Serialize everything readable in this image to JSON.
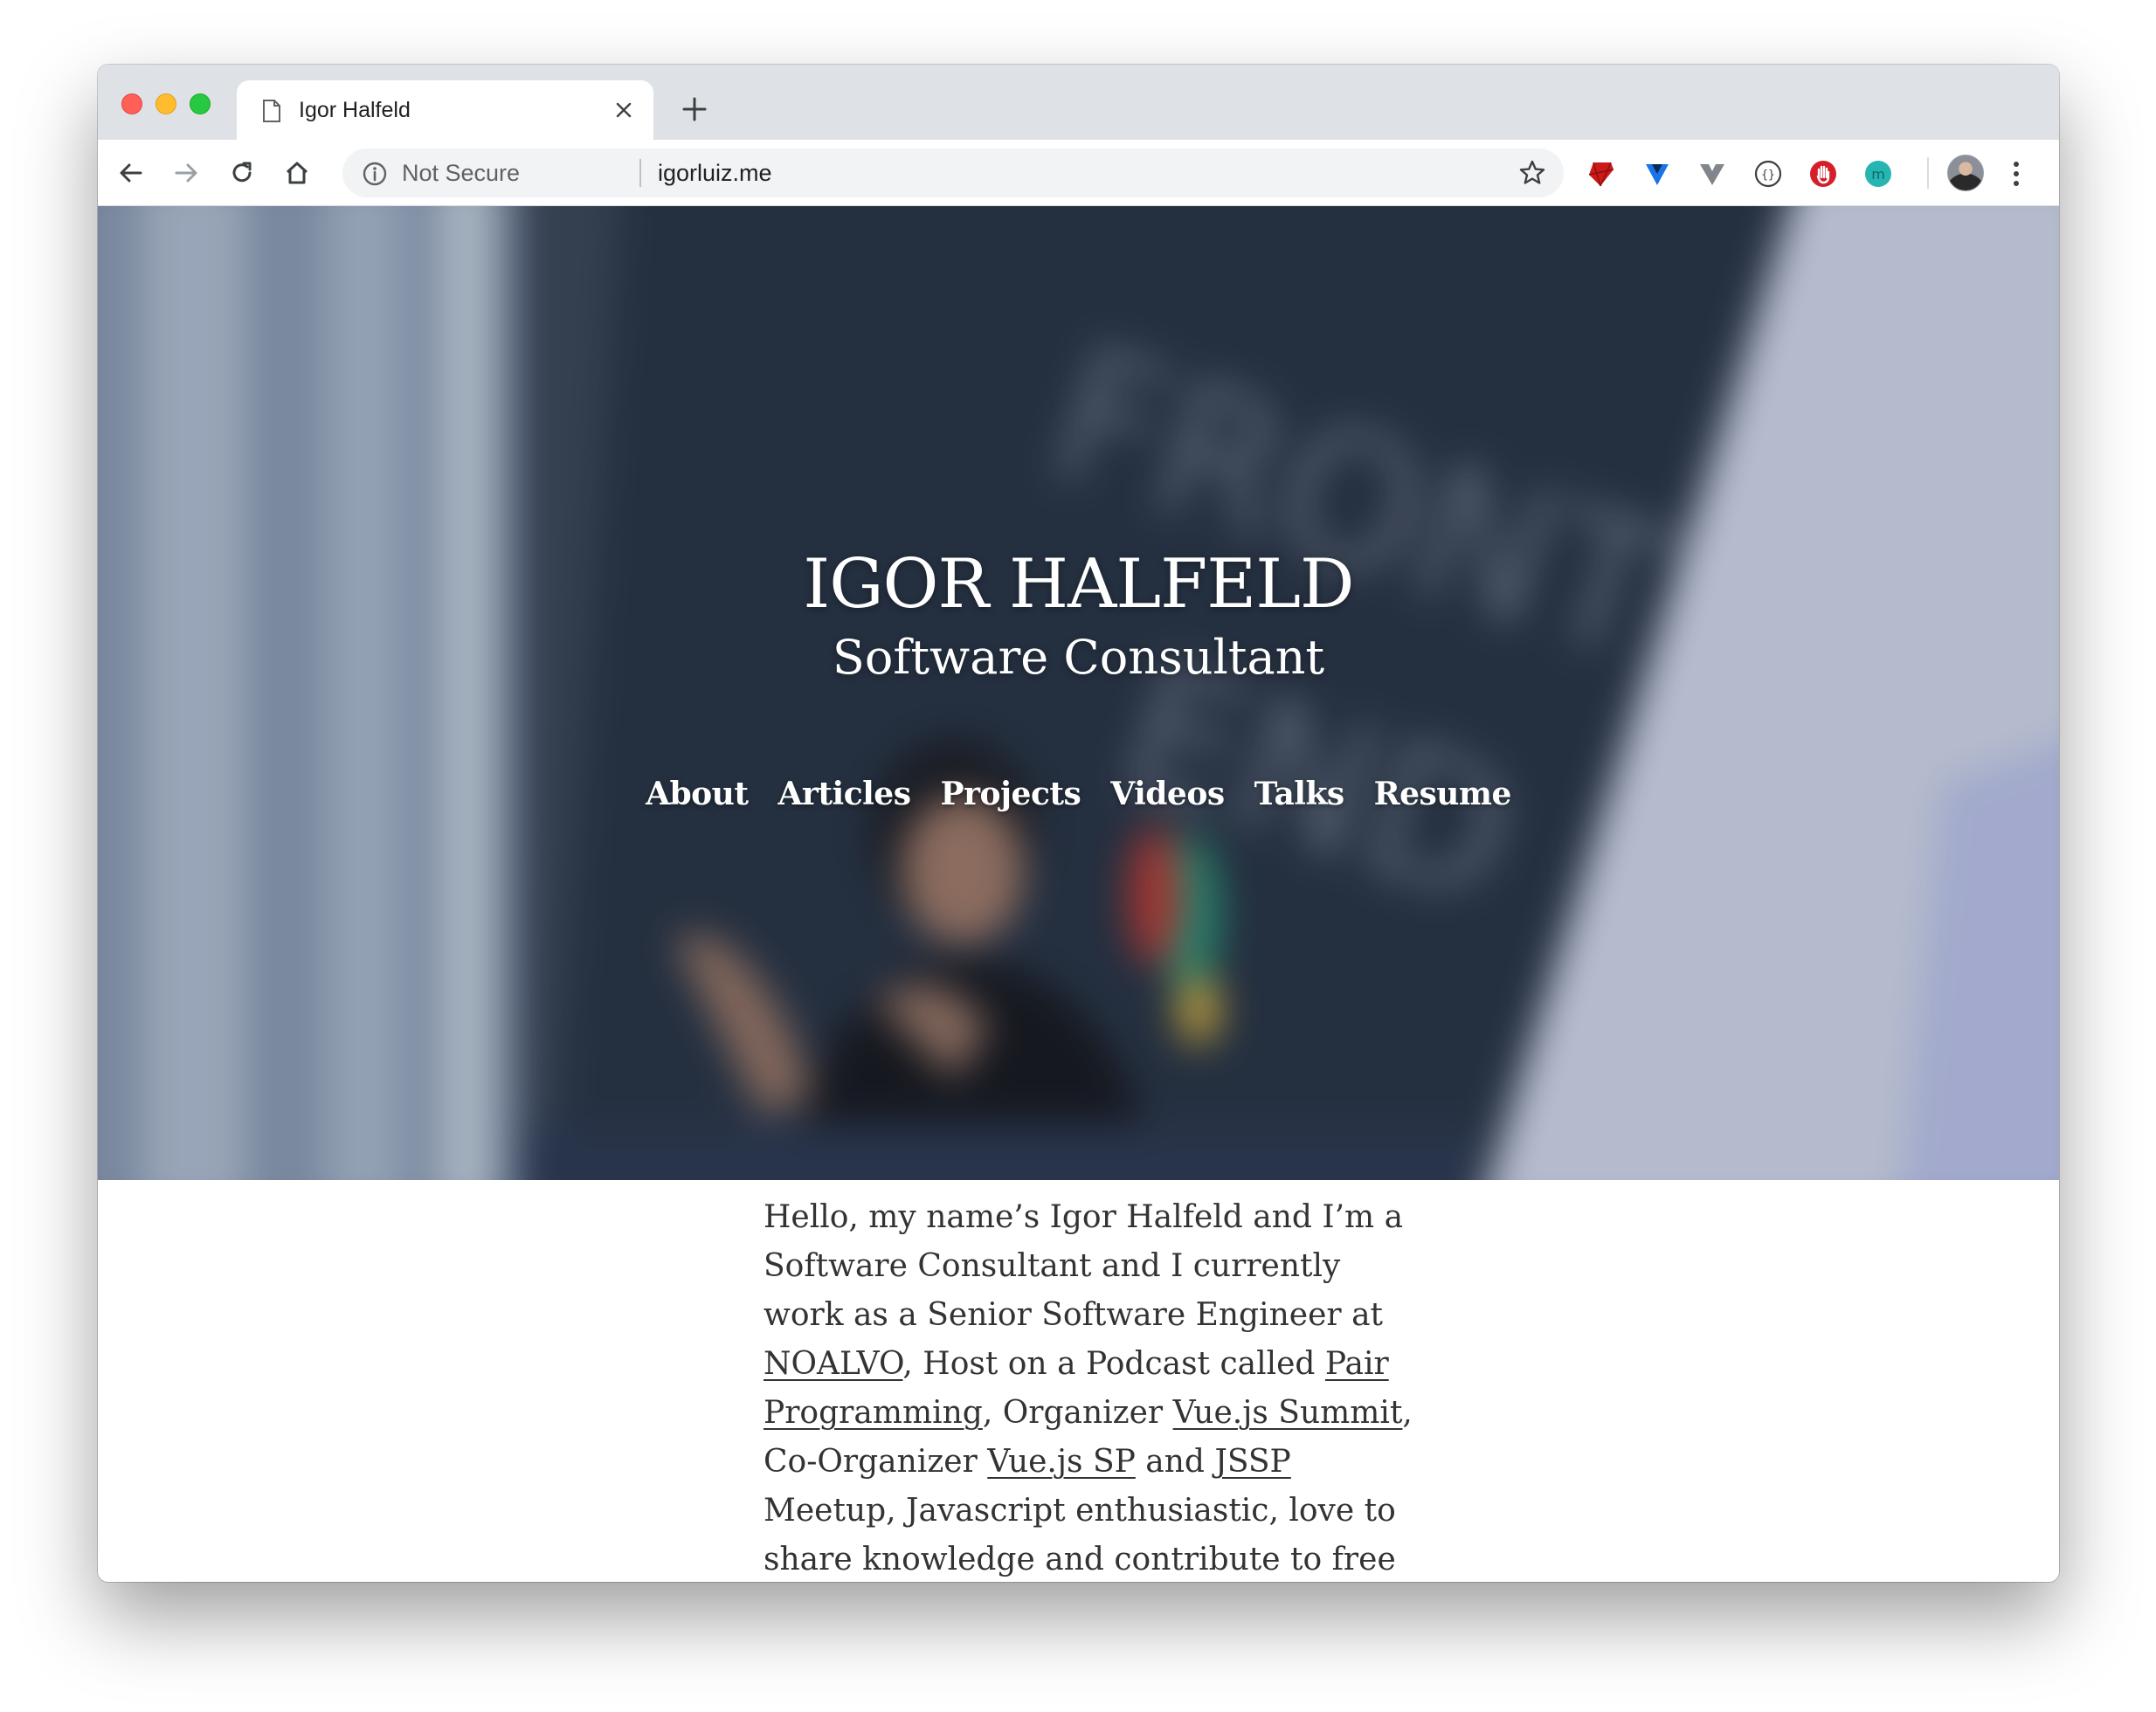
{
  "browser": {
    "tab_title": "Igor Halfeld",
    "security_label": "Not Secure",
    "url": "igorluiz.me"
  },
  "hero": {
    "title": "IGOR HALFELD",
    "subtitle": "Software Consultant",
    "nav": [
      "About",
      "Articles",
      "Projects",
      "Videos",
      "Talks",
      "Resume"
    ]
  },
  "intro": {
    "part1": "Hello, my name’s Igor Halfeld and I’m a Software Consultant and I currently work as a Senior Software Engineer at ",
    "link_noalvo": "NOALVO",
    "part2": ", Host on a Podcast called ",
    "link_pair_programming": "Pair Programming",
    "part3": ", Organizer ",
    "link_vuejs_summit": "Vue.js Summit",
    "part4": ", Co-Organizer ",
    "link_vuejs_sp": "Vue.js SP",
    "part5": " and ",
    "link_jssp": "JSSP",
    "part6": " Meetup, Javascript enthusiastic, love to share knowledge and contribute to free"
  },
  "colors": {
    "tabstrip": "#dee1e6",
    "omnibox": "#f1f3f4",
    "traffic_close": "#fe5f57",
    "traffic_min": "#febc2e",
    "traffic_max": "#28c840",
    "body_text": "#333333"
  },
  "icons": [
    "back-arrow-icon",
    "forward-arrow-icon",
    "reload-icon",
    "home-icon",
    "info-icon",
    "star-icon",
    "ruby-extension-icon",
    "vue-devtools-extension-icon",
    "v-extension-icon",
    "json-extension-icon",
    "ublock-extension-icon",
    "mercury-extension-icon",
    "profile-avatar",
    "more-menu-icon"
  ]
}
